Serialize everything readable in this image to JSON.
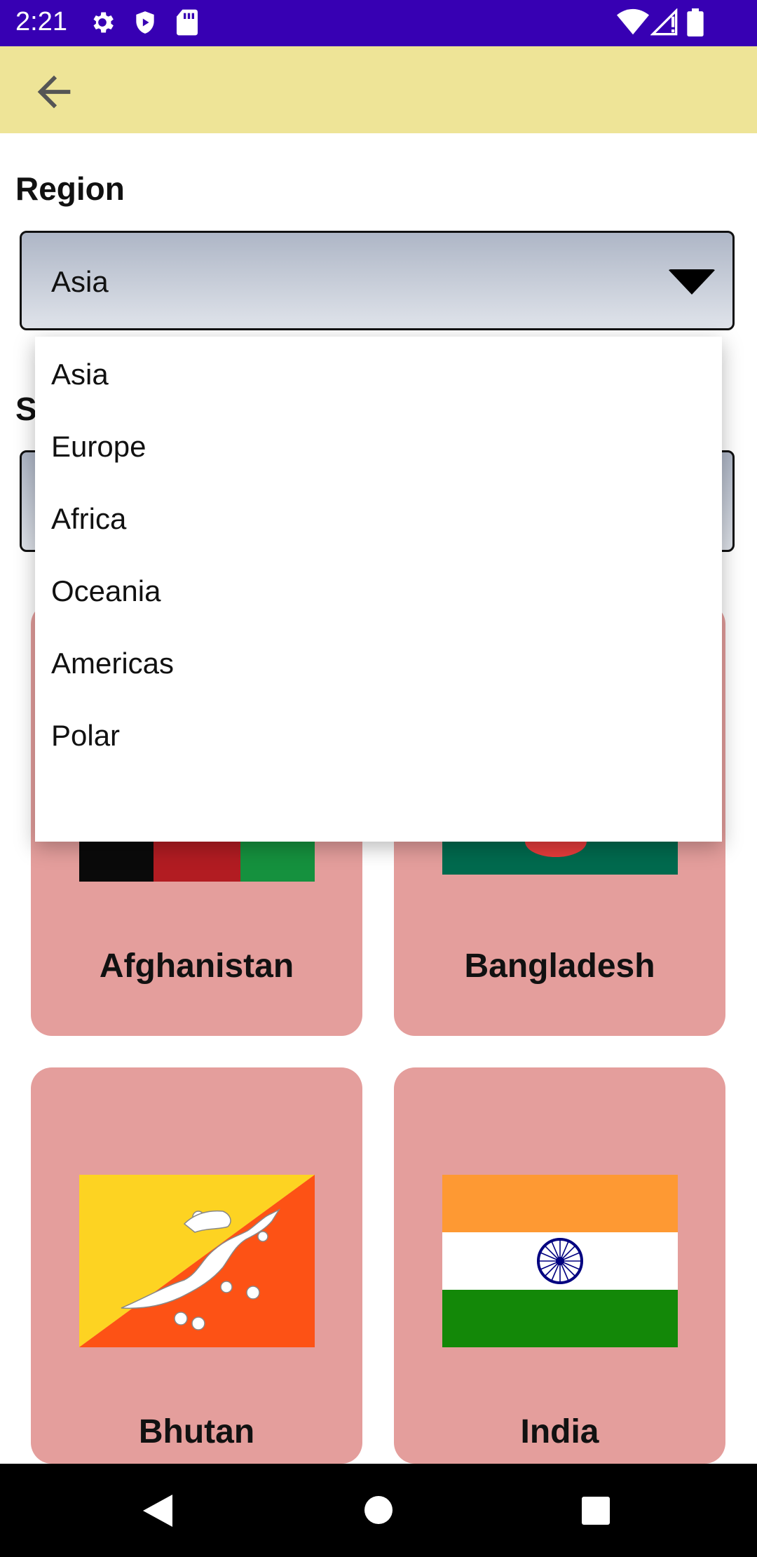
{
  "status_bar": {
    "time": "2:21",
    "icons": [
      "gear-icon",
      "shield-icon",
      "sd-card-icon",
      "wifi-icon",
      "signal-icon",
      "battery-icon"
    ]
  },
  "app_bar": {
    "back_icon": "arrow-left-icon",
    "color": "#eee497"
  },
  "form": {
    "region_label": "Region",
    "region_selected": "Asia",
    "second_label_partial": "S"
  },
  "dropdown": {
    "options": [
      "Asia",
      "Europe",
      "Africa",
      "Oceania",
      "Americas",
      "Polar"
    ]
  },
  "countries": [
    {
      "name": "Afghanistan",
      "flag": "afghanistan-flag"
    },
    {
      "name": "Bangladesh",
      "flag": "bangladesh-flag"
    },
    {
      "name": "Bhutan",
      "flag": "bhutan-flag"
    },
    {
      "name": "India",
      "flag": "india-flag"
    }
  ],
  "nav_bar": {
    "icons": [
      "back-triangle-icon",
      "home-circle-icon",
      "recents-square-icon"
    ]
  },
  "colors": {
    "status_bar": "#3700b3",
    "card": "#e49e9c",
    "spinner_top": "#aeb6c6",
    "spinner_bottom": "#dfe3ea"
  }
}
